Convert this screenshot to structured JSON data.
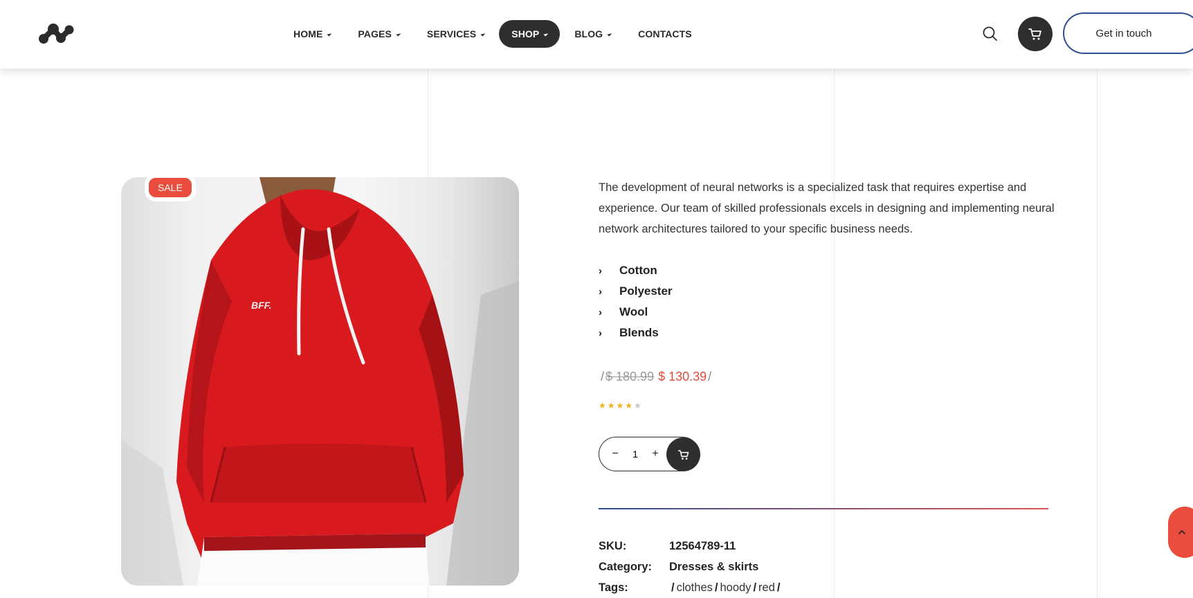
{
  "header": {
    "nav": [
      {
        "label": "HOME",
        "caret": true,
        "active": false
      },
      {
        "label": "PAGES",
        "caret": true,
        "active": false
      },
      {
        "label": "SERVICES",
        "caret": true,
        "active": false
      },
      {
        "label": "SHOP",
        "caret": true,
        "active": true
      },
      {
        "label": "BLOG",
        "caret": true,
        "active": false
      },
      {
        "label": "CONTACTS",
        "caret": false,
        "active": false
      }
    ],
    "cta_label": "Get in touch"
  },
  "product": {
    "badge": "SALE",
    "description": "The development of neural networks is a specialized task that requires expertise and experience. Our team of skilled professionals excels in designing and implementing neural network architectures tailored to your specific business needs.",
    "features": [
      "Cotton",
      "Polyester",
      "Wool",
      "Blends"
    ],
    "price_old": "$ 180.99",
    "price_new": "$ 130.39",
    "rating": 4,
    "rating_max": 5,
    "quantity": "1",
    "meta": {
      "sku_label": "SKU:",
      "sku_value": "12564789-11",
      "category_label": "Category:",
      "category_value": "Dresses & skirts",
      "tags_label": "Tags:",
      "tags": [
        "clothes",
        "hoody",
        "red"
      ]
    }
  },
  "colors": {
    "accent_red": "#ea4c3d",
    "dark": "#2e2e2e",
    "star": "#f2b21c",
    "hoodie_red": "#d8191d"
  }
}
